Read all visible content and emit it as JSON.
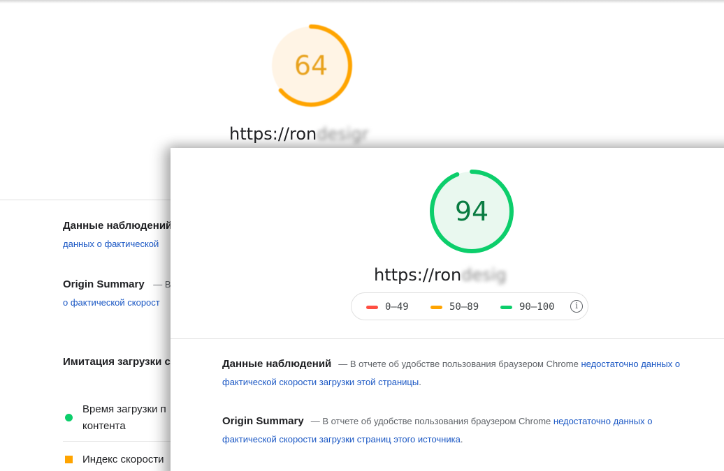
{
  "back_report": {
    "score": "64",
    "score_color": "#ffa400",
    "url": "https://ron",
    "url_blurred": "desigr",
    "observations_title": "Данные наблюдений",
    "observations_link": "данных о фактической",
    "origin_title": "Origin Summary",
    "origin_dash": "— В",
    "origin_link": "о фактической скорост",
    "lab_title": "Имитация загрузки с",
    "metrics": [
      {
        "line1": "Время загрузки п",
        "line2": "контента",
        "status": "green"
      },
      {
        "line1": "Индекс скорости",
        "line2": "",
        "status": "orange"
      }
    ]
  },
  "front_report": {
    "score": "94",
    "score_color": "#0cce6b",
    "url": "https://ron",
    "url_blurred": "desig",
    "legend": [
      {
        "label": "0–49",
        "color": "#ff4e42"
      },
      {
        "label": "50–89",
        "color": "#ffa400"
      },
      {
        "label": "90–100",
        "color": "#0cce6b"
      }
    ],
    "info_icon": "info-icon",
    "observations": {
      "title": "Данные наблюдений",
      "text": "— В отчете об удобстве пользования браузером Chrome ",
      "link": "недостаточно данных о фактической скорости загрузки этой страницы",
      "end": "."
    },
    "origin": {
      "title": "Origin Summary",
      "text": "— В отчете об удобстве пользования браузером Chrome ",
      "link": "недостаточно данных о фактической скорости загрузки страниц этого источника",
      "end": "."
    }
  }
}
